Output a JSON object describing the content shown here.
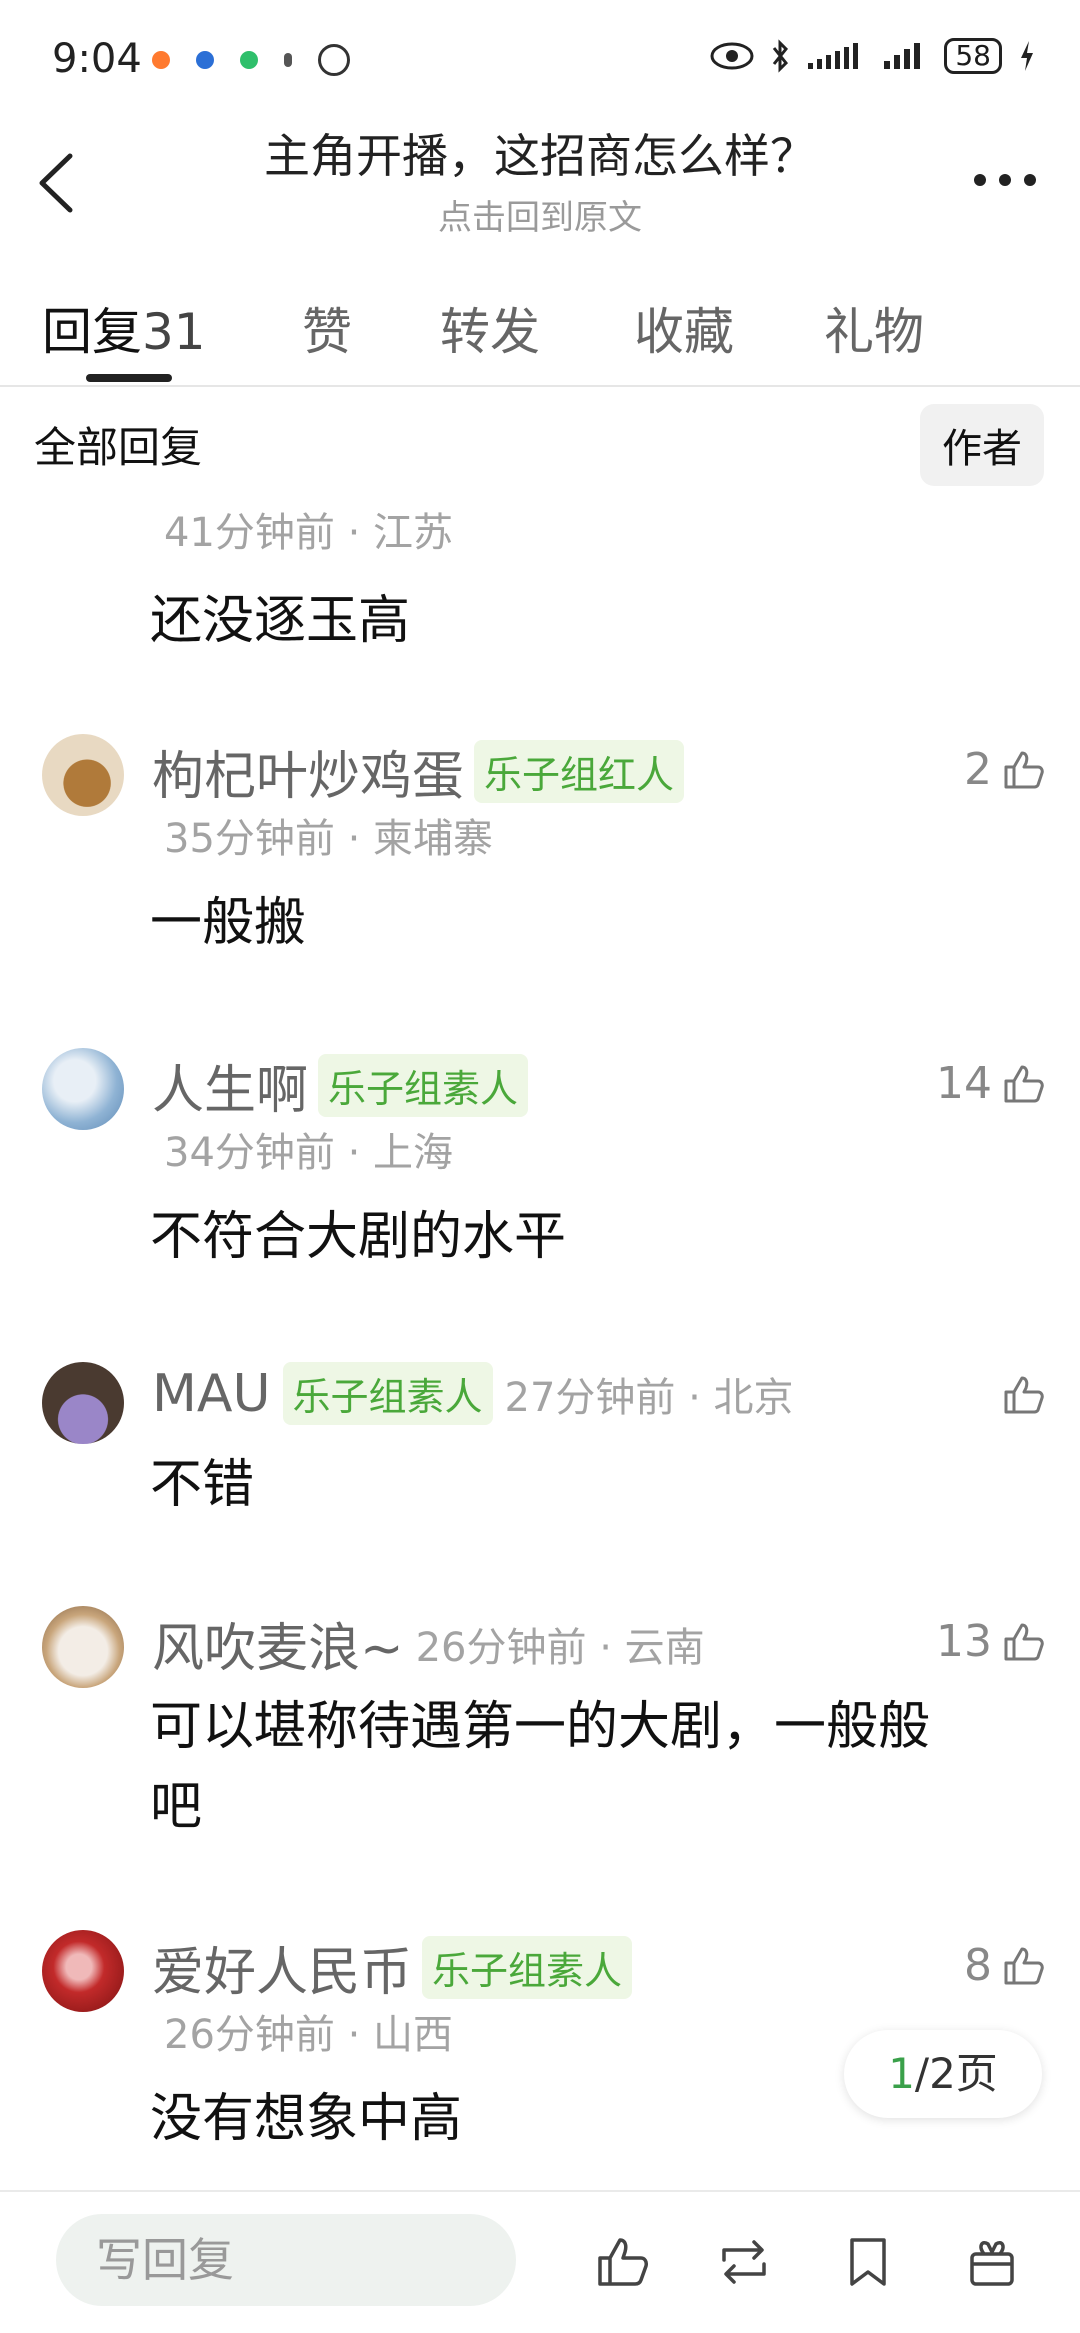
{
  "status": {
    "time": "9:04",
    "battery": "58"
  },
  "header": {
    "title": "主角开播，这招商怎么样？",
    "subtitle": "点击回到原文"
  },
  "tabs": {
    "replies_label": "回复",
    "replies_count": "31",
    "likes_label": "赞",
    "forward_label": "转发",
    "fav_label": "收藏",
    "gift_label": "礼物"
  },
  "filter": {
    "label": "全部回复",
    "author_btn": "作者"
  },
  "comments": [
    {
      "meta": "41分钟前 · 江苏",
      "text": "还没逐玉高"
    },
    {
      "name": "枸杞叶炒鸡蛋",
      "badge": "乐子组红人",
      "likes": "2",
      "meta": "35分钟前 · 柬埔寨",
      "text": "一般搬"
    },
    {
      "name": "人生啊",
      "badge": "乐子组素人",
      "likes": "14",
      "meta": "34分钟前 · 上海",
      "text": "不符合大剧的水平"
    },
    {
      "name": "MAU",
      "badge": "乐子组素人",
      "meta": "27分钟前 · 北京",
      "text": "不错"
    },
    {
      "name": "风吹麦浪~",
      "likes": "13",
      "meta": "26分钟前 · 云南",
      "text1": "可以堪称待遇第一的大剧，一般般",
      "text2": "吧"
    },
    {
      "name": "爱好人民币",
      "badge": "乐子组素人",
      "likes": "8",
      "meta": "26分钟前 · 山西",
      "text": "没有想象中高"
    }
  ],
  "pager": {
    "current": "1",
    "rest": "/2页"
  },
  "bottom": {
    "placeholder": "写回复"
  },
  "colors": {
    "accent_green": "#4aa83a",
    "badge_bg": "#eef7e5"
  }
}
